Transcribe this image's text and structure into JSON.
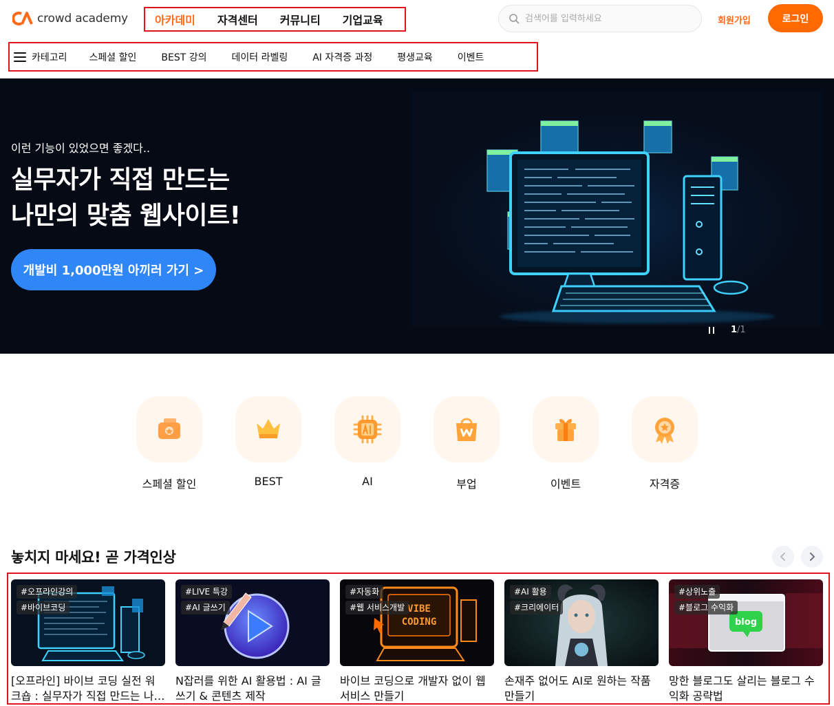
{
  "header": {
    "logo_text": "crowd academy",
    "main_nav": [
      "아카데미",
      "자격센터",
      "커뮤니티",
      "기업교육"
    ],
    "search_placeholder": "검색어를 입력하세요",
    "signup_label": "회원가입",
    "login_label": "로그인",
    "category_label": "카테고리",
    "sub_nav": [
      "스페셜 할인",
      "BEST 강의",
      "데이터 라벨링",
      "AI 자격증 과정",
      "평생교육",
      "이벤트"
    ]
  },
  "hero": {
    "eyebrow": "이런 기능이 있었으면 좋겠다..",
    "title_line1": "실무자가 직접 만드는",
    "title_line2": "나만의 맞춤 웹사이트!",
    "cta_label": "개발비 1,000만원 아끼러 가기 >",
    "pager_current": "1",
    "pager_total": "/1"
  },
  "quick_menu": [
    {
      "label": "스페셜 할인",
      "icon": "special-sale-icon"
    },
    {
      "label": "BEST",
      "icon": "crown-icon"
    },
    {
      "label": "AI",
      "icon": "ai-chip-icon"
    },
    {
      "label": "부업",
      "icon": "shopping-bag-icon"
    },
    {
      "label": "이벤트",
      "icon": "gift-icon"
    },
    {
      "label": "자격증",
      "icon": "badge-icon"
    }
  ],
  "section": {
    "title": "놓치지 마세요! 곧 가격인상"
  },
  "courses": [
    {
      "tags": [
        "#오프라인강의",
        "#바이브코딩"
      ],
      "title": "[오프라인] 바이브 코딩 실전 워크숍 : 실무자가 직접 만드는 나만의 맞춤 웹사이트"
    },
    {
      "tags": [
        "#LIVE 특강",
        "#AI 글쓰기"
      ],
      "title": "N잡러를 위한 AI 활용법 : AI 글쓰기 & 콘텐츠 제작"
    },
    {
      "tags": [
        "#자동화",
        "#웹 서비스개발"
      ],
      "title": "바이브 코딩으로 개발자 없이 웹서비스 만들기"
    },
    {
      "tags": [
        "#AI 활용",
        "#크리에이터"
      ],
      "title": "손재주 없어도 AI로 원하는 작품만들기"
    },
    {
      "tags": [
        "#상위노출",
        "#블로그 수익화"
      ],
      "title": "망한 블로그도 살리는 블로그 수익화 공략법"
    }
  ],
  "thumb_art": {
    "vibe_coding_line1": "VIBE",
    "vibe_coding_line2": "CODING",
    "blog_badge": "blog"
  },
  "colors": {
    "brand_orange": "#ff6a00",
    "highlight_red": "#e0141b",
    "cta_blue": "#2f86f6",
    "hero_bg": "#050a14"
  }
}
